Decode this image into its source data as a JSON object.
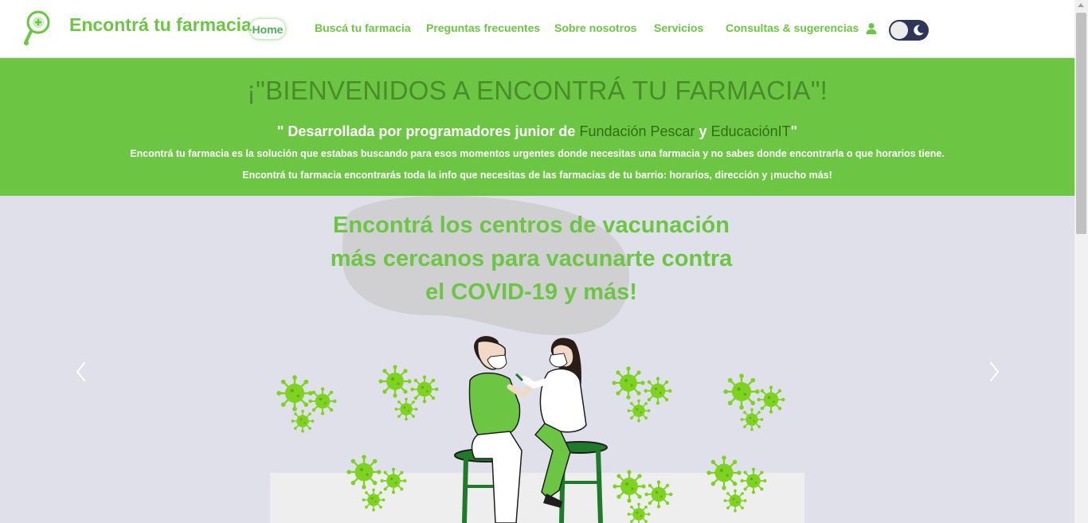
{
  "brand": {
    "name": "Encontrá tu farmacia"
  },
  "nav": {
    "items": [
      {
        "label": "Home",
        "active": true
      },
      {
        "label": "Buscá tu farmacia"
      },
      {
        "label": "Preguntas frecuentes"
      },
      {
        "label": "Sobre nosotros"
      },
      {
        "label": "Servicios"
      },
      {
        "label": "Consultas & sugerencias"
      }
    ],
    "user_icon": "user-icon",
    "theme_toggle_icon": "moon-icon"
  },
  "banner": {
    "title": "¡\"BIENVENIDOS A ENCONTRÁ TU FARMACIA\"!",
    "subtitle_prefix": "\" Desarrollada por programadores junior de ",
    "org1": "Fundación Pescar",
    "subtitle_mid": " y ",
    "org2": "EducaciónIT",
    "subtitle_suffix": "\"",
    "paragraph1": "Encontrá tu farmacia es la solución que estabas buscando para esos momentos urgentes donde necesitas una farmacia y no sabes donde encontrarla o que horarios tiene.",
    "paragraph2": "Encontrá tu farmacia encontrarás toda la info que necesitas de las farmacias de tu barrio: horarios, dirección y ¡mucho más!"
  },
  "carousel": {
    "heading": "Encontrá los centros de vacunación más cercanos para vacunarte contra el COVID-19 y más!",
    "prev_icon": "chevron-left-icon",
    "next_icon": "chevron-right-icon"
  },
  "colors": {
    "accent": "#6cc644",
    "dark_green": "#4a8c2a",
    "virus": "#7ed321",
    "toggle_bg": "#2f3558",
    "carousel_bg": "#dfe0ea"
  }
}
